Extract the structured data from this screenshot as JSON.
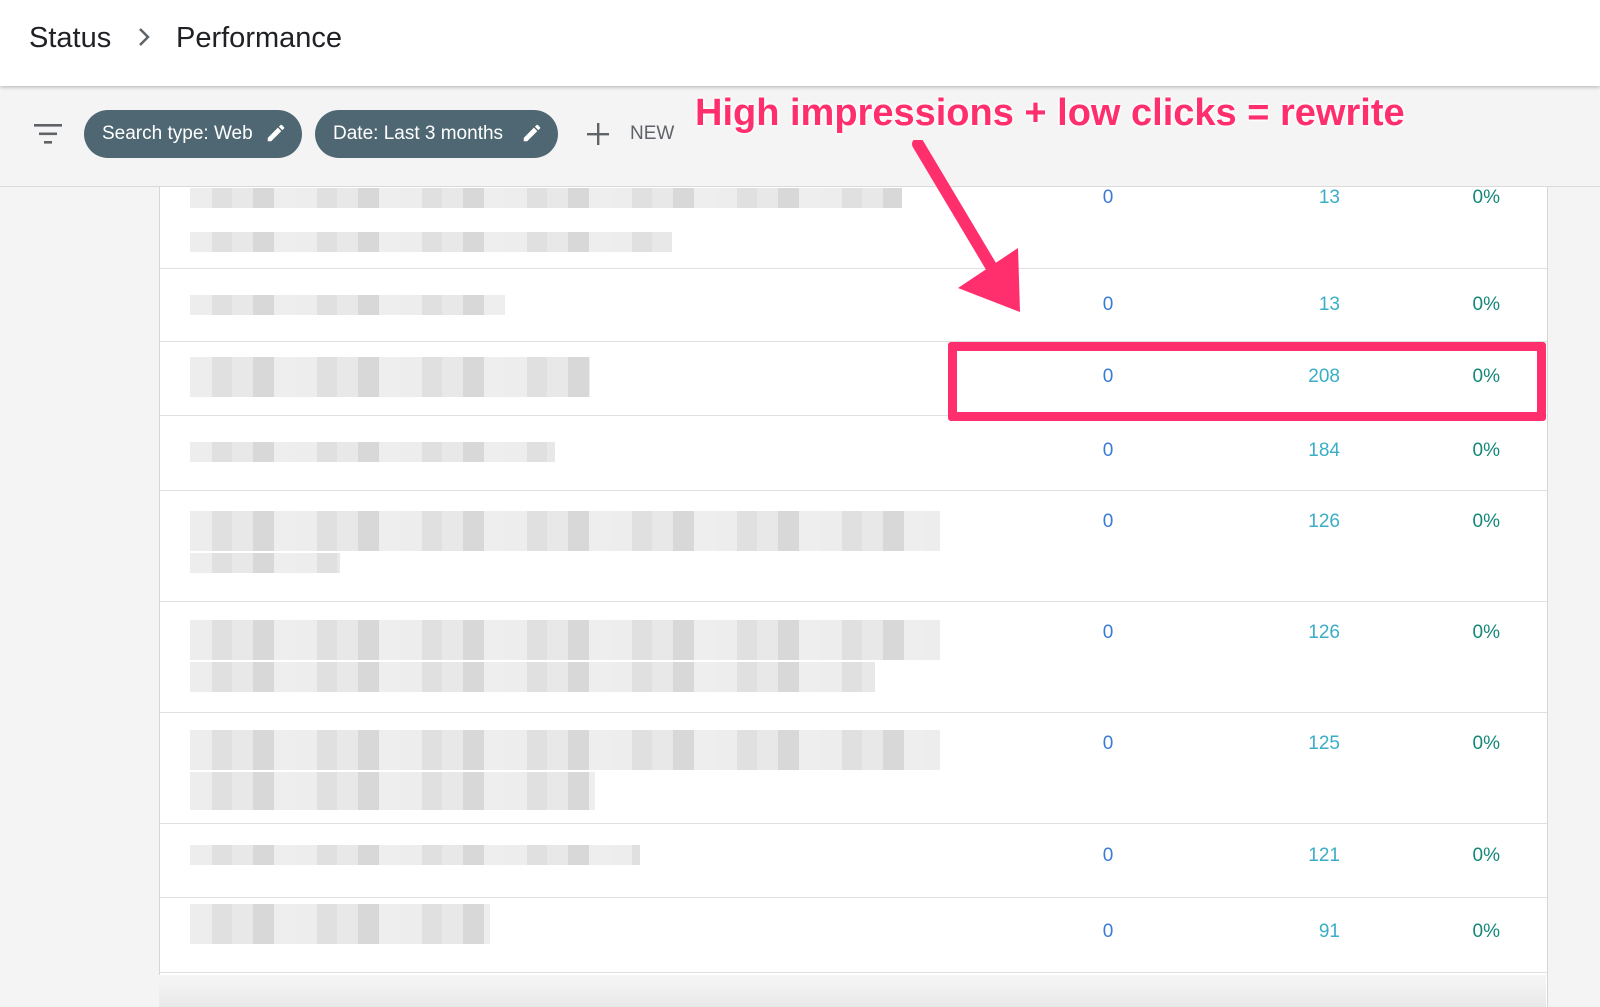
{
  "breadcrumb": {
    "root": "Status",
    "current": "Performance"
  },
  "filters": {
    "search_type": "Search type: Web",
    "date": "Date: Last 3 months",
    "new_label": "NEW"
  },
  "annotation": {
    "text": "High impressions + low clicks = rewrite",
    "color": "#ff2f6e"
  },
  "table": {
    "rows": [
      {
        "clicks": "0",
        "impressions": "13",
        "ctr": "0%"
      },
      {
        "clicks": "0",
        "impressions": "13",
        "ctr": "0%"
      },
      {
        "clicks": "0",
        "impressions": "208",
        "ctr": "0%",
        "highlighted": true
      },
      {
        "clicks": "0",
        "impressions": "184",
        "ctr": "0%"
      },
      {
        "clicks": "0",
        "impressions": "126",
        "ctr": "0%"
      },
      {
        "clicks": "0",
        "impressions": "126",
        "ctr": "0%"
      },
      {
        "clicks": "0",
        "impressions": "125",
        "ctr": "0%"
      },
      {
        "clicks": "0",
        "impressions": "121",
        "ctr": "0%"
      },
      {
        "clicks": "0",
        "impressions": "91",
        "ctr": "0%"
      }
    ]
  },
  "colors": {
    "chip_bg": "#4f6773",
    "clicks": "#3a7bd5",
    "impressions": "#3aaec7",
    "ctr": "#14877a"
  },
  "icons": [
    "chevron-right-icon",
    "filter-icon",
    "pencil-icon",
    "plus-icon"
  ]
}
